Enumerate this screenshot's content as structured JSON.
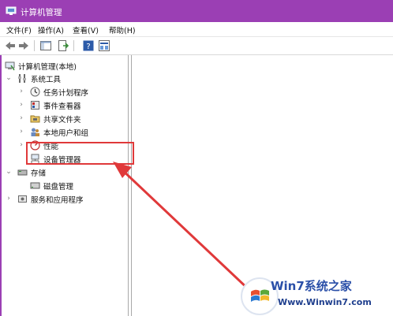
{
  "window": {
    "title": "计算机管理",
    "accent_color": "#9b3fb4",
    "title_icon": "computer-management-icon"
  },
  "menu": {
    "items": [
      "文件(F)",
      "操作(A)",
      "查看(V)",
      "帮助(H)"
    ]
  },
  "toolbar": {
    "buttons": [
      "back-arrow-icon",
      "forward-arrow-icon",
      "show-hide-console-tree-icon",
      "export-list-icon",
      "help-icon",
      "properties-icon"
    ]
  },
  "tree": {
    "root": "计算机管理(本地)",
    "system_tools": "系统工具",
    "task_scheduler": "任务计划程序",
    "event_viewer": "事件查看器",
    "shared_folders": "共享文件夹",
    "local_users": "本地用户和组",
    "performance": "性能",
    "device_manager": "设备管理器",
    "storage": "存储",
    "disk_management": "磁盘管理",
    "services_apps": "服务和应用程序"
  },
  "annotation": {
    "highlight_color": "#e0393a",
    "highlighted_item": "设备管理器"
  },
  "watermark": {
    "title": "Win7系统之家",
    "url": "Www.Winwin7.com"
  }
}
